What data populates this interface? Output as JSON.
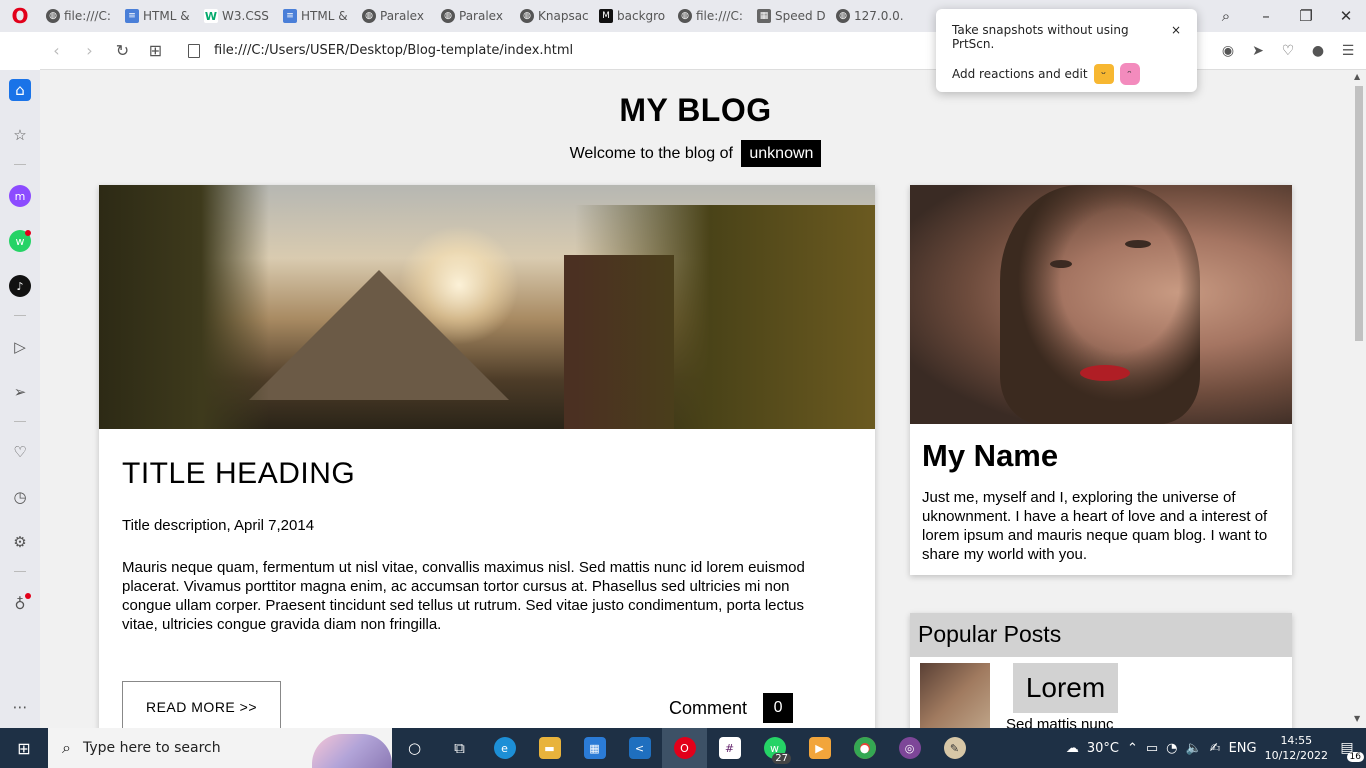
{
  "browser": {
    "logo": "O",
    "tabs": [
      {
        "label": "file:///C:",
        "icon": "globe-icon"
      },
      {
        "label": "HTML &",
        "icon": "docs-icon"
      },
      {
        "label": "W3.CSS",
        "icon": "w3-icon"
      },
      {
        "label": "HTML &",
        "icon": "docs-icon"
      },
      {
        "label": "Paralex",
        "icon": "globe-icon"
      },
      {
        "label": "Paralex",
        "icon": "globe-icon"
      },
      {
        "label": "Knapsac",
        "icon": "globe-icon"
      },
      {
        "label": "backgro",
        "icon": "medium-icon"
      },
      {
        "label": "file:///C:",
        "icon": "globe-icon"
      },
      {
        "label": "Speed D",
        "icon": "grid-icon"
      },
      {
        "label": "127.0.0.",
        "icon": "globe-icon"
      }
    ],
    "url": "file:///C:/Users/USER/Desktop/Blog-template/index.html"
  },
  "snapshot_popup": {
    "line1": "Take snapshots without using PrtScn.",
    "line2": "Add reactions and edit",
    "close": "×"
  },
  "blog": {
    "title": "MY BLOG",
    "welcome": "Welcome to the blog of",
    "owner": "unknown",
    "post": {
      "title": "TITLE HEADING",
      "description": "Title description, April 7,2014",
      "body": "Mauris neque quam, fermentum ut nisl vitae, convallis maximus nisl. Sed mattis nunc id lorem euismod placerat. Vivamus porttitor magna enim, ac accumsan tortor cursus at. Phasellus sed ultricies mi non congue ullam corper. Praesent tincidunt sed tellus ut rutrum. Sed vitae justo condimentum, porta lectus vitae, ultricies congue gravida diam non fringilla.",
      "read_more": "READ MORE >>",
      "comment_label": "Comment",
      "comment_count": "0"
    },
    "profile": {
      "name": "My Name",
      "bio": "Just me, myself and I, exploring the universe of uknownment. I have a heart of love and a interest of lorem ipsum and mauris neque quam blog. I want to share my world with you."
    },
    "popular": {
      "heading": "Popular Posts",
      "item_title": "Lorem",
      "item_sub": "Sed mattis nunc"
    }
  },
  "taskbar": {
    "search_placeholder": "Type here to search",
    "whatsapp_badge": "27",
    "weather": "30°C",
    "language": "ENG",
    "time": "14:55",
    "date": "10/12/2022",
    "notifications": "16"
  }
}
